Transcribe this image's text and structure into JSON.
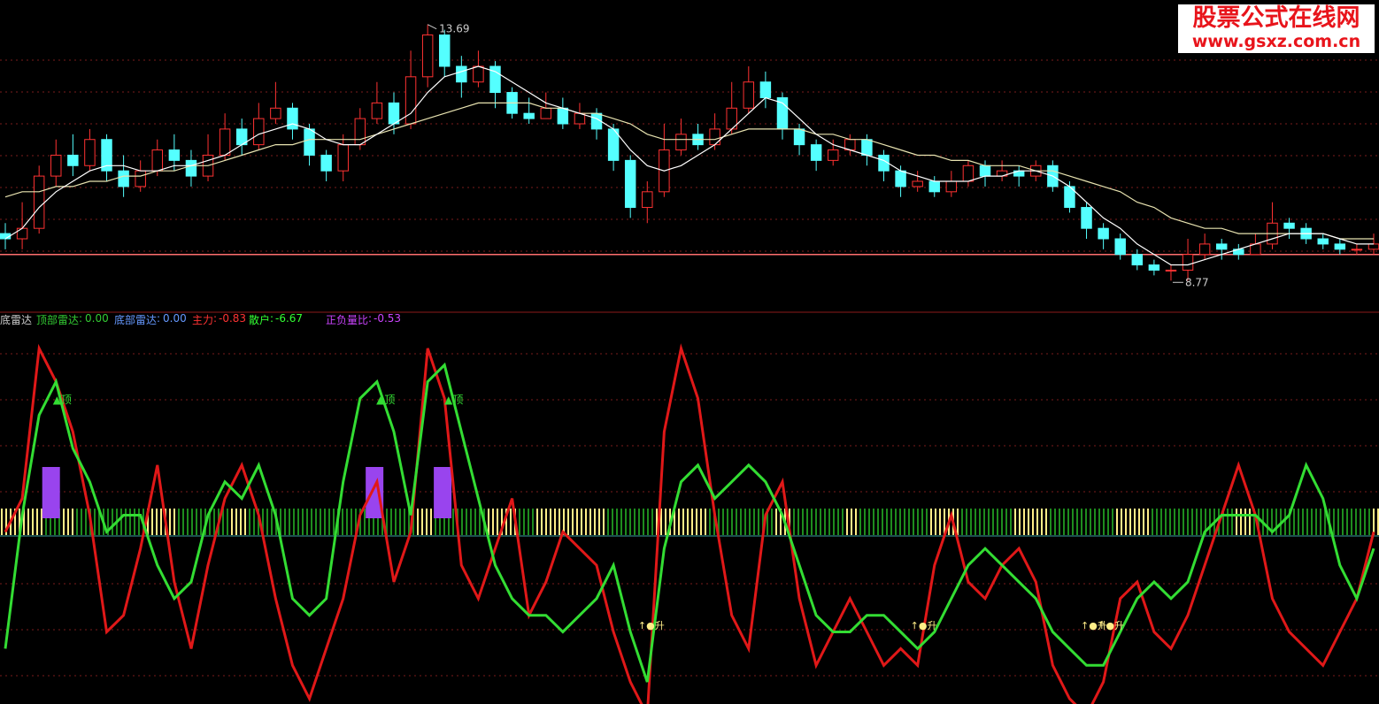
{
  "watermark": {
    "line1": "股票公式在线网",
    "line2": "www.gsxz.com.cn"
  },
  "indicator": {
    "name": "底雷达",
    "top_radar": {
      "label": "顶部雷达",
      "value": "0.00",
      "color": "#33cc33"
    },
    "bottom_radar": {
      "label": "底部雷达",
      "value": "0.00",
      "color": "#6699ff"
    },
    "main_force": {
      "label": "主力",
      "value": "-0.83",
      "color": "#ff3333"
    },
    "retail": {
      "label": "散户",
      "value": "-6.67",
      "color": "#33ff33"
    },
    "pos_neg_ratio": {
      "label": "正负量比",
      "value": "-0.53",
      "color": "#cc44ff"
    }
  },
  "chart_data": [
    {
      "type": "candlestick",
      "price_high_label": "13.69",
      "price_low_label": "8.77",
      "price_range": [
        8.5,
        14.0
      ],
      "support_line_value": 9.3,
      "candles": [
        [
          9.7,
          9.6,
          9.9,
          9.4
        ],
        [
          9.6,
          9.8,
          10.3,
          9.4
        ],
        [
          9.8,
          10.8,
          11.0,
          9.7
        ],
        [
          10.8,
          11.2,
          11.5,
          10.6
        ],
        [
          11.2,
          11.0,
          11.6,
          10.8
        ],
        [
          11.0,
          11.5,
          11.7,
          10.9
        ],
        [
          11.5,
          10.9,
          11.6,
          10.7
        ],
        [
          10.9,
          10.6,
          11.2,
          10.4
        ],
        [
          10.6,
          10.9,
          11.1,
          10.5
        ],
        [
          10.9,
          11.3,
          11.5,
          10.8
        ],
        [
          11.3,
          11.1,
          11.6,
          10.9
        ],
        [
          11.1,
          10.8,
          11.3,
          10.6
        ],
        [
          10.8,
          11.2,
          11.6,
          10.7
        ],
        [
          11.2,
          11.7,
          12.0,
          11.1
        ],
        [
          11.7,
          11.4,
          11.9,
          11.2
        ],
        [
          11.4,
          11.9,
          12.2,
          11.3
        ],
        [
          11.9,
          12.1,
          12.6,
          11.8
        ],
        [
          12.1,
          11.7,
          12.2,
          11.5
        ],
        [
          11.7,
          11.2,
          11.8,
          11.0
        ],
        [
          11.2,
          10.9,
          11.3,
          10.7
        ],
        [
          10.9,
          11.4,
          11.6,
          10.7
        ],
        [
          11.4,
          11.9,
          12.1,
          11.3
        ],
        [
          11.9,
          12.2,
          12.6,
          11.8
        ],
        [
          12.2,
          11.8,
          12.4,
          11.6
        ],
        [
          11.8,
          12.7,
          13.2,
          11.7
        ],
        [
          12.7,
          13.5,
          13.7,
          12.5
        ],
        [
          13.5,
          12.9,
          13.6,
          12.7
        ],
        [
          12.9,
          12.6,
          13.1,
          12.3
        ],
        [
          12.6,
          12.9,
          13.2,
          12.5
        ],
        [
          12.9,
          12.4,
          13.0,
          12.1
        ],
        [
          12.4,
          12.0,
          12.5,
          11.9
        ],
        [
          12.0,
          11.9,
          12.3,
          11.8
        ],
        [
          11.9,
          12.1,
          12.4,
          11.9
        ],
        [
          12.1,
          11.8,
          12.3,
          11.7
        ],
        [
          11.8,
          12.0,
          12.2,
          11.7
        ],
        [
          12.0,
          11.7,
          12.1,
          11.5
        ],
        [
          11.7,
          11.1,
          11.8,
          10.9
        ],
        [
          11.1,
          10.2,
          11.2,
          10.0
        ],
        [
          10.2,
          10.5,
          10.7,
          9.9
        ],
        [
          10.5,
          11.3,
          11.8,
          10.4
        ],
        [
          11.3,
          11.6,
          11.9,
          11.2
        ],
        [
          11.6,
          11.4,
          11.8,
          11.3
        ],
        [
          11.4,
          11.7,
          12.0,
          11.3
        ],
        [
          11.7,
          12.1,
          12.6,
          11.6
        ],
        [
          12.1,
          12.6,
          12.9,
          12.0
        ],
        [
          12.6,
          12.3,
          12.8,
          12.1
        ],
        [
          12.3,
          11.7,
          12.4,
          11.5
        ],
        [
          11.7,
          11.4,
          11.8,
          11.2
        ],
        [
          11.4,
          11.1,
          11.5,
          10.9
        ],
        [
          11.1,
          11.3,
          11.5,
          11.0
        ],
        [
          11.3,
          11.5,
          11.6,
          11.2
        ],
        [
          11.5,
          11.2,
          11.6,
          11.0
        ],
        [
          11.2,
          10.9,
          11.3,
          10.7
        ],
        [
          10.9,
          10.6,
          11.0,
          10.4
        ],
        [
          10.6,
          10.7,
          10.9,
          10.5
        ],
        [
          10.7,
          10.5,
          10.8,
          10.4
        ],
        [
          10.5,
          10.7,
          10.9,
          10.4
        ],
        [
          10.7,
          11.0,
          11.1,
          10.6
        ],
        [
          11.0,
          10.8,
          11.1,
          10.6
        ],
        [
          10.8,
          10.9,
          11.1,
          10.7
        ],
        [
          10.9,
          10.8,
          11.0,
          10.6
        ],
        [
          10.8,
          11.0,
          11.1,
          10.7
        ],
        [
          11.0,
          10.6,
          11.1,
          10.5
        ],
        [
          10.6,
          10.2,
          10.7,
          10.1
        ],
        [
          10.2,
          9.8,
          10.3,
          9.6
        ],
        [
          9.8,
          9.6,
          9.9,
          9.4
        ],
        [
          9.6,
          9.3,
          9.7,
          9.2
        ],
        [
          9.3,
          9.1,
          9.4,
          9.0
        ],
        [
          9.1,
          9.0,
          9.2,
          8.9
        ],
        [
          9.0,
          9.0,
          9.1,
          8.8
        ],
        [
          9.0,
          9.3,
          9.6,
          8.8
        ],
        [
          9.3,
          9.5,
          9.7,
          9.2
        ],
        [
          9.5,
          9.4,
          9.6,
          9.2
        ],
        [
          9.4,
          9.3,
          9.5,
          9.2
        ],
        [
          9.3,
          9.5,
          9.7,
          9.3
        ],
        [
          9.5,
          9.9,
          10.3,
          9.4
        ],
        [
          9.9,
          9.8,
          10.0,
          9.6
        ],
        [
          9.8,
          9.6,
          9.9,
          9.5
        ],
        [
          9.6,
          9.5,
          9.7,
          9.4
        ],
        [
          9.5,
          9.4,
          9.6,
          9.3
        ],
        [
          9.4,
          9.4,
          9.5,
          9.3
        ],
        [
          9.4,
          9.5,
          9.7,
          9.3
        ]
      ],
      "ma_short": [
        9.6,
        9.8,
        10.2,
        10.5,
        10.7,
        10.9,
        11.0,
        11.0,
        10.9,
        10.9,
        11.0,
        11.0,
        11.1,
        11.2,
        11.4,
        11.6,
        11.7,
        11.8,
        11.7,
        11.5,
        11.4,
        11.4,
        11.6,
        11.8,
        12.0,
        12.4,
        12.7,
        12.8,
        12.9,
        12.8,
        12.6,
        12.4,
        12.2,
        12.1,
        12.0,
        11.9,
        11.7,
        11.3,
        11.0,
        10.9,
        11.0,
        11.2,
        11.4,
        11.7,
        12.0,
        12.3,
        12.2,
        11.9,
        11.6,
        11.4,
        11.3,
        11.2,
        11.1,
        10.9,
        10.8,
        10.7,
        10.7,
        10.7,
        10.8,
        10.8,
        10.9,
        10.9,
        10.8,
        10.6,
        10.3,
        10.0,
        9.8,
        9.5,
        9.3,
        9.1,
        9.1,
        9.2,
        9.3,
        9.4,
        9.5,
        9.6,
        9.7,
        9.7,
        9.7,
        9.6,
        9.5,
        9.5
      ],
      "ma_long": [
        10.4,
        10.5,
        10.5,
        10.6,
        10.6,
        10.7,
        10.7,
        10.8,
        10.8,
        10.9,
        10.9,
        11.0,
        11.0,
        11.1,
        11.2,
        11.3,
        11.4,
        11.4,
        11.5,
        11.5,
        11.5,
        11.5,
        11.6,
        11.7,
        11.8,
        11.9,
        12.0,
        12.1,
        12.2,
        12.2,
        12.2,
        12.2,
        12.1,
        12.1,
        12.0,
        12.0,
        11.9,
        11.8,
        11.6,
        11.5,
        11.5,
        11.5,
        11.5,
        11.6,
        11.7,
        11.7,
        11.7,
        11.7,
        11.6,
        11.6,
        11.5,
        11.5,
        11.4,
        11.3,
        11.2,
        11.2,
        11.1,
        11.1,
        11.0,
        11.0,
        11.0,
        10.9,
        10.9,
        10.8,
        10.7,
        10.6,
        10.5,
        10.3,
        10.2,
        10.0,
        9.9,
        9.8,
        9.8,
        9.7,
        9.7,
        9.7,
        9.7,
        9.7,
        9.7,
        9.6,
        9.6,
        9.6
      ]
    },
    {
      "type": "line",
      "y_range": [
        -8,
        14
      ],
      "main_force_series": [
        2,
        4,
        13,
        11,
        8,
        3,
        -4,
        -3,
        1,
        6,
        -1,
        -5,
        0,
        4,
        6,
        3,
        -2,
        -6,
        -8,
        -5,
        -2,
        3,
        5,
        -1,
        2,
        13,
        10,
        0,
        -2,
        1,
        4,
        -3,
        -1,
        2,
        1,
        0,
        -4,
        -7,
        -9,
        8,
        13,
        10,
        3,
        -3,
        -5,
        3,
        5,
        -2,
        -6,
        -4,
        -2,
        -4,
        -6,
        -5,
        -6,
        0,
        3,
        -1,
        -2,
        0,
        1,
        -1,
        -6,
        -8,
        -9,
        -7,
        -2,
        -1,
        -4,
        -5,
        -3,
        0,
        3,
        6,
        3,
        -2,
        -4,
        -5,
        -6,
        -4,
        -2,
        2
      ],
      "retail_series": [
        -5,
        3,
        9,
        11,
        7,
        5,
        2,
        3,
        3,
        0,
        -2,
        -1,
        3,
        5,
        4,
        6,
        3,
        -2,
        -3,
        -2,
        5,
        10,
        11,
        8,
        3,
        11,
        12,
        8,
        4,
        0,
        -2,
        -3,
        -3,
        -4,
        -3,
        -2,
        0,
        -4,
        -7,
        1,
        5,
        6,
        4,
        5,
        6,
        5,
        3,
        0,
        -3,
        -4,
        -4,
        -3,
        -3,
        -4,
        -5,
        -4,
        -2,
        0,
        1,
        0,
        -1,
        -2,
        -4,
        -5,
        -6,
        -6,
        -4,
        -2,
        -1,
        -2,
        -1,
        2,
        3,
        3,
        3,
        2,
        3,
        6,
        4,
        0,
        -2,
        1
      ],
      "top_radar_labels": [
        "▲顶",
        "▲顶",
        "▲顶",
        "▲顶"
      ],
      "rise_labels": [
        "↑●升",
        "↑●升",
        "↑●升",
        "↑●升"
      ]
    }
  ]
}
